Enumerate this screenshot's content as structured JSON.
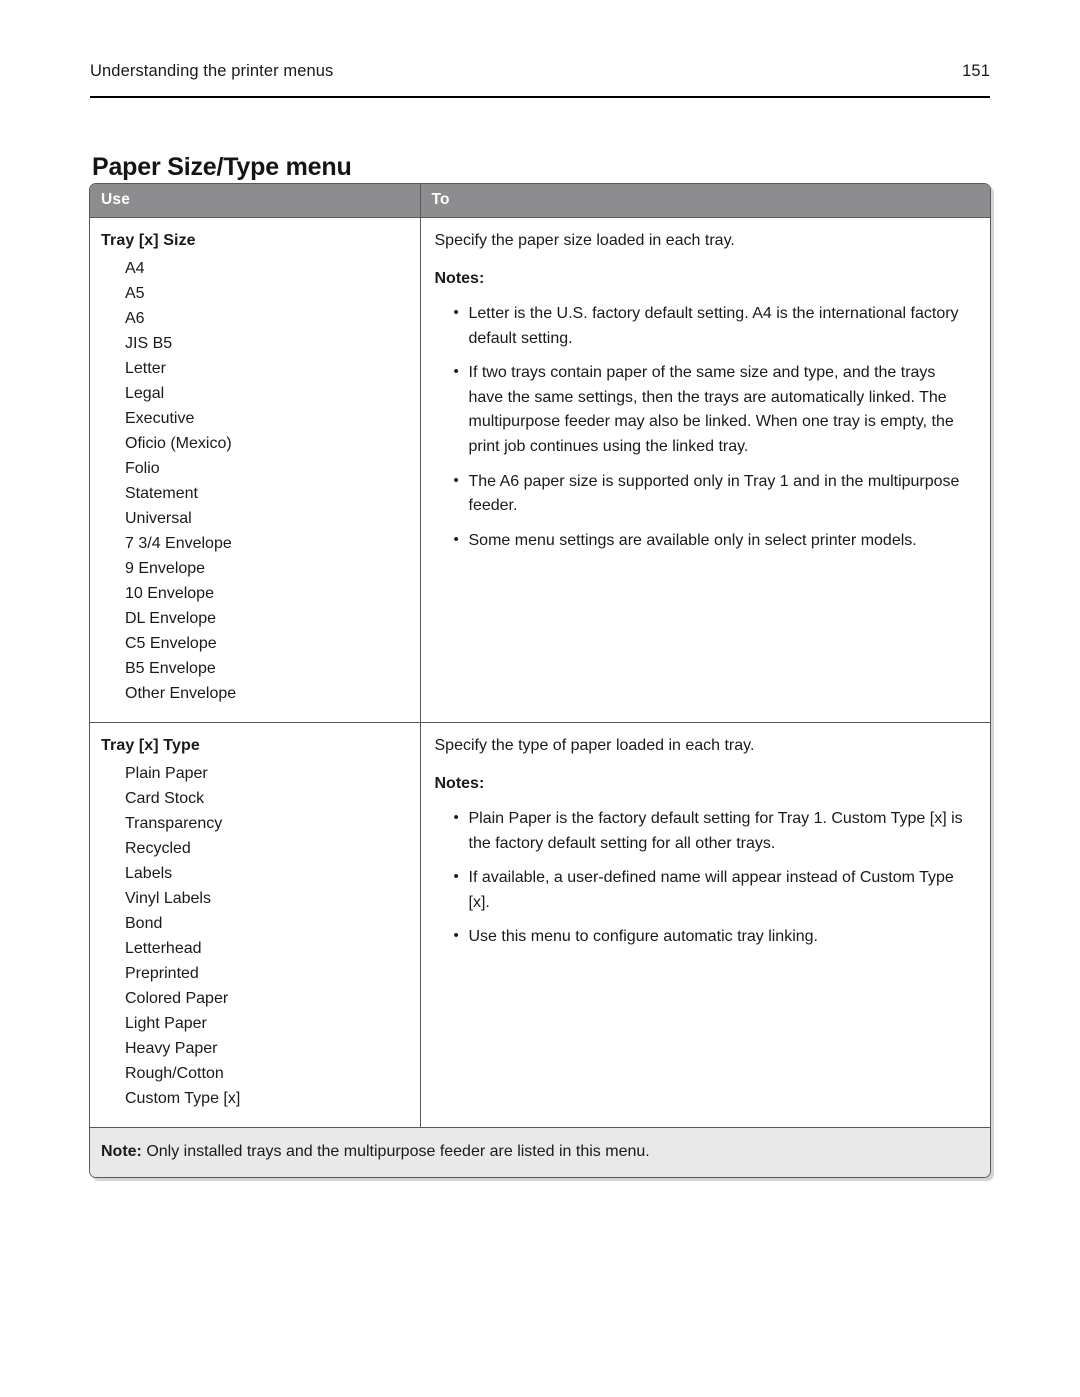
{
  "page": {
    "running_header_title": "Understanding the printer menus",
    "page_number": "151",
    "section_title": "Paper Size/Type menu"
  },
  "table": {
    "columns": {
      "use": "Use",
      "to": "To"
    },
    "rows": [
      {
        "setting": "Tray [x] Size",
        "options": [
          "A4",
          "A5",
          "A6",
          "JIS B5",
          "Letter",
          "Legal",
          "Executive",
          "Oficio (Mexico)",
          "Folio",
          "Statement",
          "Universal",
          "7 3/4 Envelope",
          "9 Envelope",
          "10 Envelope",
          "DL Envelope",
          "C5 Envelope",
          "B5 Envelope",
          "Other Envelope"
        ],
        "description": "Specify the paper size loaded in each tray.",
        "notes_label": "Notes:",
        "notes": [
          "Letter is the U.S. factory default setting. A4 is the international factory default setting.",
          "If two trays contain paper of the same size and type, and the trays have the same settings, then the trays are automatically linked. The multipurpose feeder may also be linked. When one tray is empty, the print job continues using the linked tray.",
          "The A6 paper size is supported only in Tray 1 and in the multipurpose feeder.",
          "Some menu settings are available only in select printer models."
        ]
      },
      {
        "setting": "Tray [x] Type",
        "options": [
          "Plain Paper",
          "Card Stock",
          "Transparency",
          "Recycled",
          "Labels",
          "Vinyl Labels",
          "Bond",
          "Letterhead",
          "Preprinted",
          "Colored Paper",
          "Light Paper",
          "Heavy Paper",
          "Rough/Cotton",
          "Custom Type [x]"
        ],
        "description": "Specify the type of paper loaded in each tray.",
        "notes_label": "Notes:",
        "notes": [
          "Plain Paper is the factory default setting for Tray 1. Custom Type [x] is the factory default setting for all other trays.",
          "If available, a user-defined name will appear instead of Custom Type [x].",
          "Use this menu to configure automatic tray linking."
        ]
      }
    ],
    "footer_note": {
      "label": "Note:",
      "text": "Only installed trays and the multipurpose feeder are listed in this menu."
    }
  },
  "colors": {
    "table_header_bg": "#8d8d8f",
    "table_border": "#59595b",
    "footer_note_bg": "#e9e9e9",
    "text": "#1a1a1a"
  }
}
